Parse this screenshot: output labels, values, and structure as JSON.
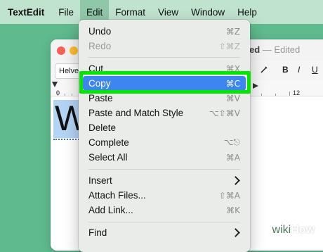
{
  "menubar": {
    "items": [
      "TextEdit",
      "File",
      "Edit",
      "Format",
      "View",
      "Window",
      "Help"
    ],
    "active": "Edit"
  },
  "window": {
    "title": "ed",
    "edited": "— Edited",
    "font_box": "Helve",
    "format_buttons": [
      "B",
      "I",
      "U"
    ],
    "ruler_numbers": [
      "0",
      "12"
    ],
    "doc_text": "W"
  },
  "edit_menu": {
    "items": [
      {
        "label": "Undo",
        "shortcut": "⌘Z",
        "enabled": true
      },
      {
        "label": "Redo",
        "shortcut": "⇧⌘Z",
        "enabled": false
      },
      {
        "label": "Cut",
        "shortcut": "⌘X",
        "enabled": true
      },
      {
        "label": "Copy",
        "shortcut": "⌘C",
        "enabled": true,
        "selected": true
      },
      {
        "label": "Paste",
        "shortcut": "⌘V",
        "enabled": true
      },
      {
        "label": "Paste and Match Style",
        "shortcut": "⌥⇧⌘V",
        "enabled": true
      },
      {
        "label": "Delete",
        "shortcut": "",
        "enabled": true
      },
      {
        "label": "Complete",
        "shortcut": "⌥⎋",
        "enabled": true
      },
      {
        "label": "Select All",
        "shortcut": "⌘A",
        "enabled": true
      },
      {
        "label": "Insert",
        "shortcut": "",
        "submenu": true
      },
      {
        "label": "Attach Files...",
        "shortcut": "⇧⌘A",
        "enabled": true
      },
      {
        "label": "Add Link...",
        "shortcut": "⌘K",
        "enabled": true
      },
      {
        "label": "Find",
        "shortcut": "",
        "submenu": true
      }
    ]
  },
  "colors": {
    "background": "#5fba8e",
    "highlight_box": "#00e600",
    "selection": "#3d86f2"
  },
  "watermark": {
    "wiki": "wiki",
    "how": "How"
  }
}
